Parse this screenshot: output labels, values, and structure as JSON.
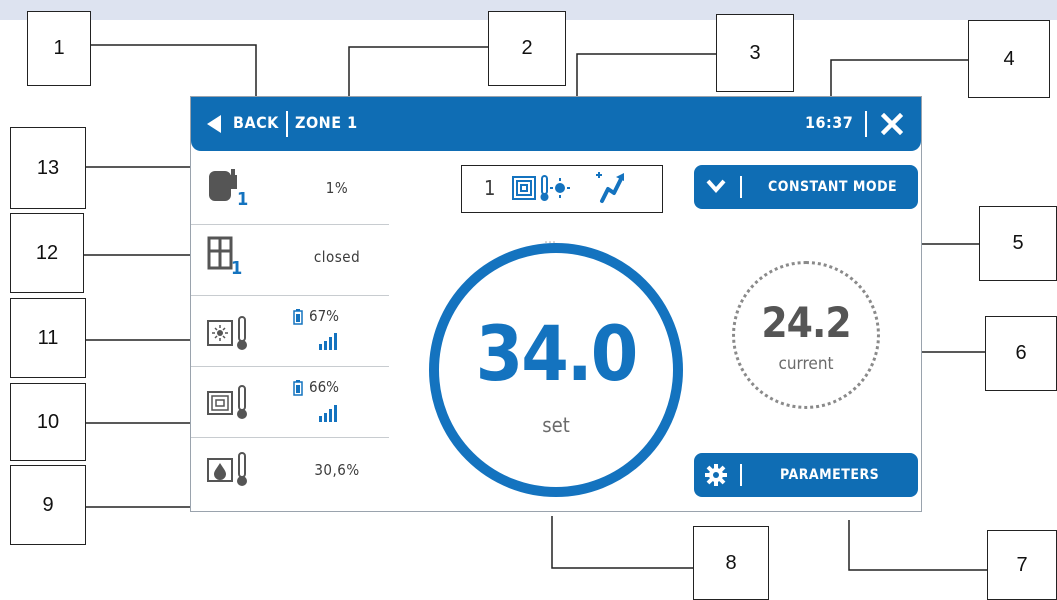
{
  "header": {
    "back_label": "BACK",
    "zone_label": "ZONE 1",
    "time": "16:37",
    "close_label": "X"
  },
  "sidebar": {
    "rows": [
      {
        "icon": "actuator-icon",
        "badge": "1",
        "value": "1%"
      },
      {
        "icon": "window-sensor-icon",
        "badge": "1",
        "value": "closed"
      },
      {
        "icon": "room-sensor-thermometer-icon",
        "battery": "67%",
        "signal": "signal-icon"
      },
      {
        "icon": "floor-sensor-thermometer-icon",
        "battery": "66%",
        "signal": "signal-icon"
      },
      {
        "icon": "humidity-sensor-icon",
        "value": "30,6%"
      }
    ]
  },
  "status": {
    "number": "1",
    "icons": [
      "floor-heating-icon",
      "thermometer-sun-icon",
      "pump-icon"
    ]
  },
  "mode_button": {
    "label": "CONSTANT MODE"
  },
  "params_button": {
    "label": "PARAMETERS"
  },
  "set_temp": {
    "value": "34.0",
    "label": "set"
  },
  "current_temp": {
    "value": "24.2",
    "label": "current"
  },
  "callouts": [
    "1",
    "2",
    "3",
    "4",
    "5",
    "6",
    "7",
    "8",
    "9",
    "10",
    "11",
    "12",
    "13"
  ],
  "colors": {
    "accent": "#0f6db4",
    "text": "#3c3c3c",
    "band": "#dde3f0"
  }
}
